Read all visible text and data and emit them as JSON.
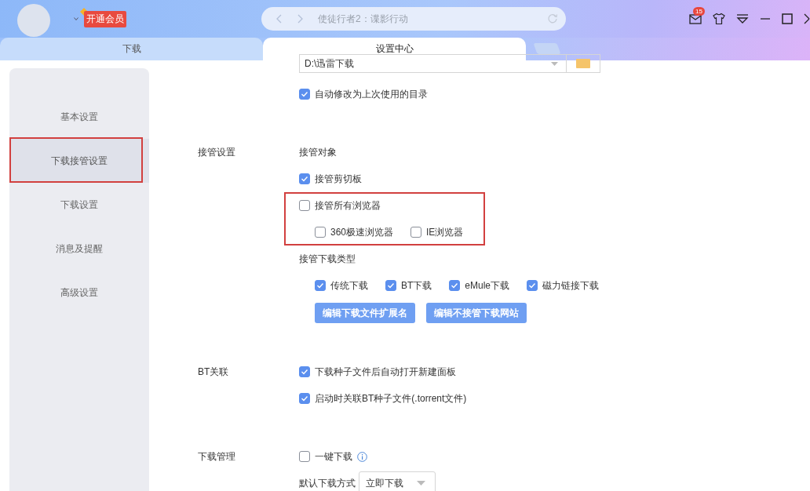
{
  "title_bar": {
    "vip_badge": "开通会员",
    "address": "使徒行者2：谍影行动",
    "mail_count": "15"
  },
  "tabs": [
    {
      "label": "下载",
      "selected": false
    },
    {
      "label": "设置中心",
      "selected": true
    }
  ],
  "sidebar": {
    "items": [
      {
        "label": "基本设置",
        "selected": false,
        "highlighted": false
      },
      {
        "label": "下载接管设置",
        "selected": true,
        "highlighted": true
      },
      {
        "label": "下载设置",
        "selected": false,
        "highlighted": false
      },
      {
        "label": "消息及提醒",
        "selected": false,
        "highlighted": false
      },
      {
        "label": "高级设置",
        "selected": false,
        "highlighted": false
      }
    ]
  },
  "sections": [
    {
      "items": [
        {
          "kind": "path",
          "value": "D:\\迅雷下载"
        },
        {
          "kind": "checkbox",
          "label": "自动修改为上次使用的目录",
          "checked": true
        }
      ]
    },
    {
      "label": "接管设置",
      "items": [
        {
          "kind": "heading",
          "text": "接管对象"
        },
        {
          "kind": "checkbox",
          "label": "接管剪切板",
          "checked": true
        },
        {
          "kind": "group",
          "highlighted": true,
          "items": [
            {
              "kind": "checkbox",
              "label": "接管所有浏览器",
              "checked": false
            },
            {
              "kind": "row",
              "options": [
                {
                  "label": "360极速浏览器",
                  "checked": false
                },
                {
                  "label": "IE浏览器",
                  "checked": false
                }
              ]
            }
          ]
        },
        {
          "kind": "heading",
          "text": "接管下载类型"
        },
        {
          "kind": "row",
          "options": [
            {
              "label": "传统下载",
              "checked": true
            },
            {
              "label": "BT下载",
              "checked": true
            },
            {
              "label": "eMule下载",
              "checked": true
            },
            {
              "label": "磁力链接下载",
              "checked": true
            }
          ]
        },
        {
          "kind": "buttons",
          "buttons": [
            "编辑下载文件扩展名",
            "编辑不接管下载网站"
          ]
        }
      ]
    },
    {
      "label": "BT关联",
      "items": [
        {
          "kind": "checkbox",
          "label": "下载种子文件后自动打开新建面板",
          "checked": true
        },
        {
          "kind": "checkbox",
          "label": "启动时关联BT种子文件(.torrent文件)",
          "checked": true
        }
      ]
    },
    {
      "label": "下载管理",
      "items": [
        {
          "kind": "checkbox",
          "label": "一键下载",
          "checked": false,
          "info": true
        },
        {
          "kind": "select",
          "label": "默认下载方式",
          "value": "立即下载"
        }
      ]
    }
  ]
}
